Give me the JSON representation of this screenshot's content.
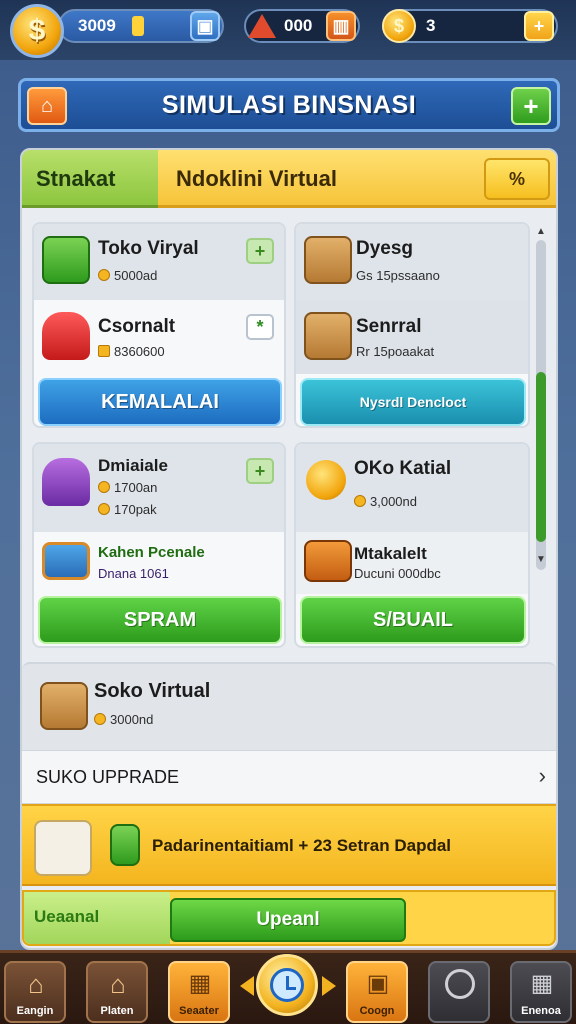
{
  "topbar": {
    "coin_badge_symbol": "$",
    "res1_value": "3009",
    "res2_value": "000",
    "res3_value": "3",
    "res1_btn_icon": "shop-icon",
    "res2_btn_icon": "chart-icon",
    "res3_btn_icon": "plus-icon"
  },
  "banner": {
    "title": "SIMULASI BINSNASI",
    "home_icon": "home-icon",
    "plus_icon": "plus-icon"
  },
  "tabs": {
    "left_label": "Stnakat",
    "right_label": "Ndoklini Virtual",
    "right_button": "%"
  },
  "cards": [
    {
      "rows": [
        {
          "name": "Toko Viryal",
          "sub": "5000ad",
          "icon": "shopping-cart-icon",
          "mini": "+"
        },
        {
          "name": "Csornalt",
          "sub": "8360600",
          "icon": "sale-tag-icon",
          "mini": "*"
        }
      ],
      "action": "KEMALALAI",
      "action_style": "blue"
    },
    {
      "rows": [
        {
          "name": "Dyesg",
          "sub": "Gs 15pssaano",
          "icon": "box-icon"
        },
        {
          "name": "Senrral",
          "sub": "Rr 15poaakat",
          "icon": "box-icon"
        }
      ],
      "action": "Nysrdl Dencloct",
      "action_style": "teal"
    },
    {
      "rows": [
        {
          "name": "Dmiaiale",
          "sub": "1700an",
          "sub2": "170pak",
          "icon": "sale-cart-icon",
          "mini": "+"
        },
        {
          "name": "Kahen Pcenale",
          "sub": "Dnana 1061",
          "icon": "monitor-icon"
        }
      ],
      "action": "SPRAM",
      "action_style": "green"
    },
    {
      "rows": [
        {
          "name": "OKo Katial",
          "sub": "3,000nd",
          "icon": "coin-icon"
        },
        {
          "name": "Mtakalelt",
          "sub": "Ducuni 000dbc",
          "icon": "cart-icon"
        }
      ],
      "action": "S/BUAIL",
      "action_style": "green"
    }
  ],
  "wide_card": {
    "name": "Soko Virtual",
    "sub": "3000nd"
  },
  "upgrade": {
    "label": "SUKO UPPRADE",
    "chevron": "›"
  },
  "promo": {
    "text": "Padarinentaitiaml + 23 Setran Dapdal"
  },
  "progress": {
    "label": "Ueaanal",
    "button": "Upeanl"
  },
  "nav": [
    {
      "label": "Eangin",
      "icon": "home-icon",
      "style": "brown"
    },
    {
      "label": "Platen",
      "icon": "house-icon",
      "style": "brown"
    },
    {
      "label": "Seaater",
      "icon": "building-icon",
      "style": "gold"
    },
    {
      "label": "Coogn",
      "icon": "bag-icon",
      "style": "gold"
    },
    {
      "label": "",
      "icon": "target-icon",
      "style": "dark"
    },
    {
      "label": "Enenoa",
      "icon": "grid-icon",
      "style": "dark"
    }
  ],
  "nav_center_icon": "clock-icon"
}
